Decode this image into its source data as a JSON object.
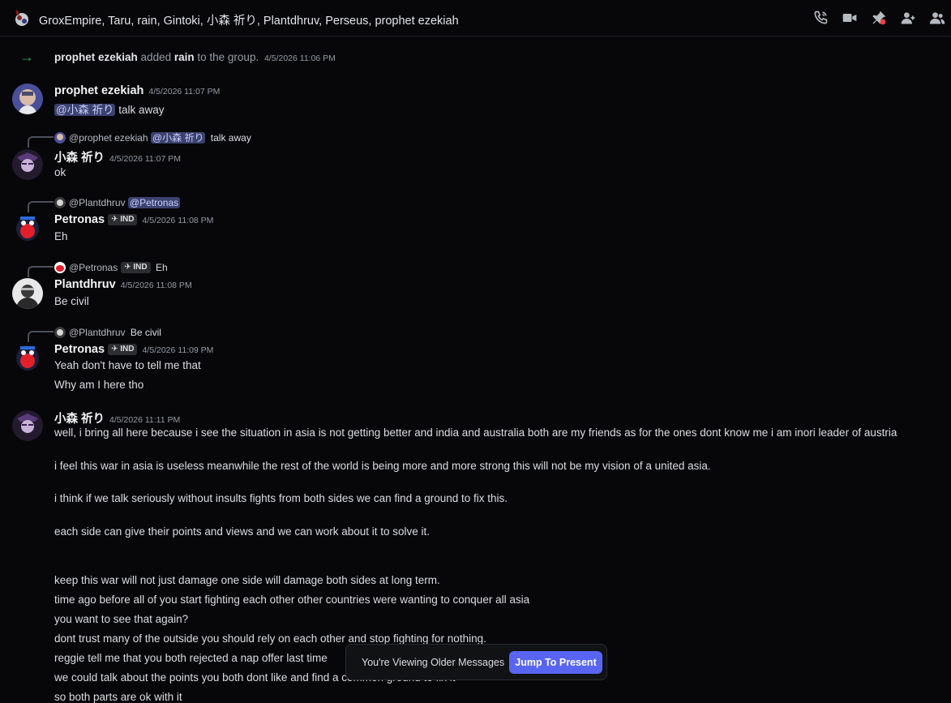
{
  "header": {
    "title": "GroxEmpire, Taru, rain, Gintoki, 小森 祈り, Plantdhruv, Perseus, prophet ezekiah",
    "icons": [
      "phone-call-icon",
      "video-camera-icon",
      "pinned-messages-icon",
      "add-member-icon",
      "member-list-icon"
    ]
  },
  "system_message": {
    "actor": "prophet ezekiah",
    "action": "added",
    "target": "rain",
    "suffix": "to the group.",
    "timestamp": "4/5/2026 11:06 PM"
  },
  "messages": [
    {
      "author": "prophet ezekiah",
      "timestamp": "4/5/2026 11:07 PM",
      "mention": "@小森 祈り",
      "text": "talk away"
    },
    {
      "reply": {
        "author": "@prophet ezekiah",
        "mention": "@小森 祈り",
        "text": "talk away"
      },
      "author": "小森 祈り",
      "timestamp": "4/5/2026 11:07 PM",
      "text": "ok"
    },
    {
      "reply": {
        "author": "@Plantdhruv",
        "mention": "@Petronas"
      },
      "author": "Petronas",
      "tag": "IND",
      "timestamp": "4/5/2026 11:08 PM",
      "text": "Eh"
    },
    {
      "reply": {
        "author": "@Petronas",
        "tag": "IND",
        "text": "Eh"
      },
      "author": "Plantdhruv",
      "timestamp": "4/5/2026 11:08 PM",
      "text": "Be civil"
    },
    {
      "reply": {
        "author": "@Plantdhruv",
        "text": "Be civil"
      },
      "author": "Petronas",
      "tag": "IND",
      "timestamp": "4/5/2026 11:09 PM",
      "lines": [
        "Yeah don't have to tell me that",
        "Why am I here tho"
      ]
    },
    {
      "author": "小森 祈り",
      "timestamp": "4/5/2026 11:11 PM",
      "lines": [
        "well, i bring all here because i see the situation in asia is not getting better and india and australia both are my friends as for the ones dont know me i am inori leader of austria",
        "i feel this war in asia is useless meanwhile the rest of the world is being more and more strong this will not be my vision of a united asia.",
        "i think if we talk seriously without insults fights from both sides we can find a ground to  fix this.",
        "each side can give their points and views and we can work about it to solve it.",
        "keep this war will not just damage one side will damage both sides at long term.",
        "time ago before all of you start fighting each other other countries were wanting to conquer all asia",
        "you want to see that again?",
        "dont trust many of the outside you should rely on each other and stop fighting for nothing.",
        "reggie tell me that you both rejected a nap offer last time",
        "we could talk about the points you both dont like and find a common ground to fix it",
        "so both parts are ok with it"
      ]
    }
  ],
  "older_banner": {
    "text": "You're Viewing Older Messages",
    "button": "Jump To Present"
  }
}
